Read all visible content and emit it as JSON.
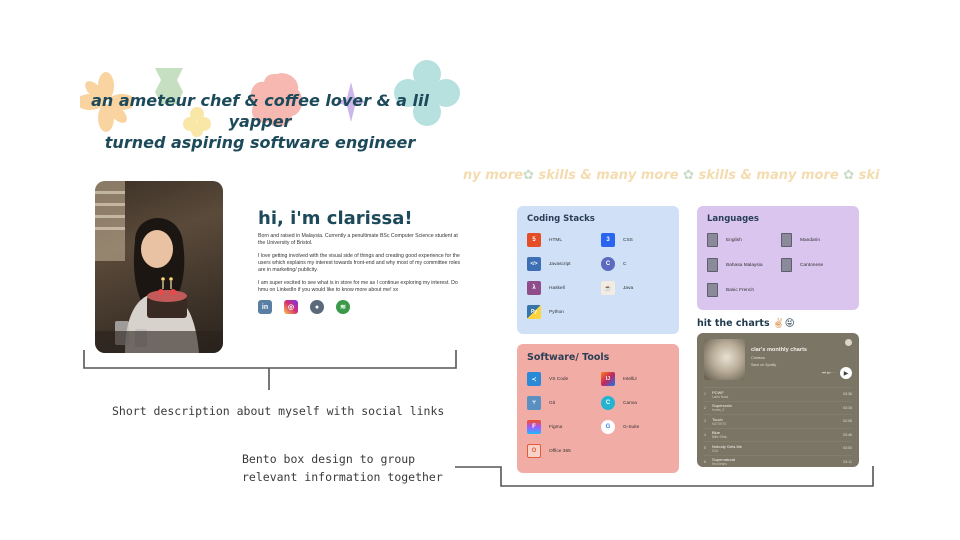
{
  "tagline": {
    "line1": "an ameteur chef & coffee lover & a lil yapper",
    "line2": "turned aspiring software engineer"
  },
  "intro": {
    "heading": "hi, i'm clarissa!",
    "para1": "Born and raised in Malaysia. Currently a penultimate BSc Computer Science student at the University of Bristol.",
    "para2": "I love getting involved with the visual side of things and creating good experience for the users which explains my interest towards front-end and why most of my committee roles are in marketing/ publicity.",
    "para3": "I am super excited to see what is in store for me as I continue exploring my interest. Do hmu on LinkedIn if you would like to know more about me! xx",
    "socials": [
      {
        "icon": "linkedin-icon",
        "glyph": "in",
        "color": "#5a7fa5"
      },
      {
        "icon": "instagram-icon",
        "glyph": "◎",
        "color": "#d6336c"
      },
      {
        "icon": "github-icon",
        "glyph": "●",
        "color": "#5a6a7a"
      },
      {
        "icon": "spotify-icon",
        "glyph": "≋",
        "color": "#3a9a4a"
      }
    ]
  },
  "captions": {
    "description": "Short description about myself with social links",
    "bento_line1": "Bento box design to group",
    "bento_line2": "relevant information together"
  },
  "marquee": {
    "text1": "ny more",
    "text2": " skills & many more ",
    "text3": " skills & many more ",
    "text4": " ski",
    "flower": "✿"
  },
  "coding": {
    "title": "Coding Stacks",
    "items": [
      {
        "label": "HTML",
        "icon": "html5-icon",
        "glyph": "5",
        "color": "#e44d26"
      },
      {
        "label": "CSS",
        "icon": "css3-icon",
        "glyph": "3",
        "color": "#2965f1"
      },
      {
        "label": "Javascript",
        "icon": "code-brackets-icon",
        "glyph": "</>",
        "color": "#3d6fb5"
      },
      {
        "label": "C",
        "icon": "c-language-icon",
        "glyph": "C",
        "color": "#5c6bc0"
      },
      {
        "label": "Haskell",
        "icon": "haskell-icon",
        "glyph": "λ",
        "color": "#8f4e8b"
      },
      {
        "label": "Java",
        "icon": "java-icon",
        "glyph": "☕",
        "color": "#e8e0d0"
      },
      {
        "label": "Python",
        "icon": "python-icon",
        "glyph": "Py",
        "color": "#3776ab"
      }
    ]
  },
  "software": {
    "title": "Software/ Tools",
    "items": [
      {
        "label": "VS Code",
        "icon": "vscode-icon",
        "glyph": "≺",
        "color": "#2b8ad8"
      },
      {
        "label": "IntelliJ",
        "icon": "intellij-icon",
        "glyph": "IJ",
        "color": "#c3265d"
      },
      {
        "label": "Git",
        "icon": "git-branch-icon",
        "glyph": "⑂",
        "color": "#5a8fc2"
      },
      {
        "label": "Canva",
        "icon": "canva-icon",
        "glyph": "C",
        "color": "#22b4d1"
      },
      {
        "label": "Figma",
        "icon": "figma-icon",
        "glyph": "F",
        "color": "#f24e1e"
      },
      {
        "label": "G-Suite",
        "icon": "google-icon",
        "glyph": "G",
        "color": "#4285f4"
      },
      {
        "label": "Office 365",
        "icon": "office-icon",
        "glyph": "O",
        "color": "#e8593a"
      }
    ]
  },
  "languages": {
    "title": "Languages",
    "items": [
      {
        "label": "English",
        "icon": "book-icon"
      },
      {
        "label": "Mandarin",
        "icon": "book-icon"
      },
      {
        "label": "Bahasa Malaysia",
        "icon": "book-icon"
      },
      {
        "label": "Cantonese",
        "icon": "book-icon"
      },
      {
        "label": "Basic French",
        "icon": "book-icon"
      }
    ]
  },
  "charts": {
    "title": "hit the charts ✌🏻😝",
    "playlist": "clar's monthly charts",
    "owner": "Clarissa",
    "save": "Save on Spotify",
    "tracks": [
      {
        "n": "1",
        "name": "PCWF",
        "artist": "Lanto Nosa",
        "dur": "03:36"
      },
      {
        "n": "2",
        "name": "Supersonic",
        "artist": "fromis_9",
        "dur": "03:16"
      },
      {
        "n": "3",
        "name": "Touch",
        "artist": "KATSEYE",
        "dur": "02:06"
      },
      {
        "n": "4",
        "name": "Blue",
        "artist": "Billie Eilish",
        "dur": "03:46"
      },
      {
        "n": "5",
        "name": "Nobody Gets Me",
        "artist": "SZA",
        "dur": "03:00"
      },
      {
        "n": "6",
        "name": "Supernatural",
        "artist": "NewJeans",
        "dur": "03:11"
      }
    ]
  },
  "colors": {
    "coding_bg": "#cfe0f7",
    "software_bg": "#f2aca6",
    "languages_bg": "#d9c5ee",
    "player_bg": "#7b7566"
  }
}
